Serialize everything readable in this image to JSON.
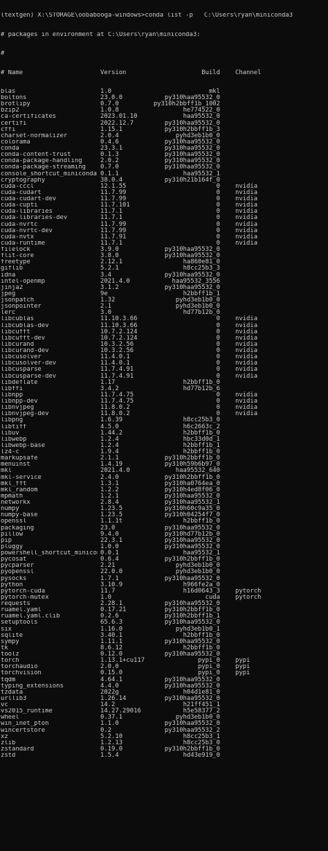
{
  "terminal": {
    "prompt_line": "(textgen) X:\\STORAGE\\oobabooga-windows>conda list -p   C:\\Users\\ryan\\miniconda3",
    "info_line": "# packages in environment at C:\\Users\\ryan\\miniconda3:",
    "hash_line": "#",
    "columns": {
      "name": "# Name",
      "version": "Version",
      "build": "Build",
      "channel": "Channel"
    },
    "packages": [
      [
        "blas",
        "1.0",
        "mkl",
        ""
      ],
      [
        "boltons",
        "23.0.0",
        "py310haa95532_0",
        ""
      ],
      [
        "brotlipy",
        "0.7.0",
        "py310h2bbff1b_1002",
        ""
      ],
      [
        "bzip2",
        "1.0.8",
        "he774522_0",
        ""
      ],
      [
        "ca-certificates",
        "2023.01.10",
        "haa95532_0",
        ""
      ],
      [
        "certifi",
        "2022.12.7",
        "py310haa95532_0",
        ""
      ],
      [
        "cffi",
        "1.15.1",
        "py310h2bbff1b_3",
        ""
      ],
      [
        "charset-normalizer",
        "2.0.4",
        "pyhd3eb1b0_0",
        ""
      ],
      [
        "colorama",
        "0.4.6",
        "py310haa95532_0",
        ""
      ],
      [
        "conda",
        "23.3.1",
        "py310haa95532_0",
        ""
      ],
      [
        "conda-content-trust",
        "0.1.3",
        "py310haa95532_0",
        ""
      ],
      [
        "conda-package-handling",
        "2.0.2",
        "py310haa95532_0",
        ""
      ],
      [
        "conda-package-streaming",
        "0.7.0",
        "py310haa95532_0",
        ""
      ],
      [
        "console_shortcut_miniconda",
        "0.1.1",
        "haa95532_1",
        ""
      ],
      [
        "cryptography",
        "38.0.4",
        "py310h21b164f_0",
        ""
      ],
      [
        "cuda-cccl",
        "12.1.55",
        "0",
        "nvidia"
      ],
      [
        "cuda-cudart",
        "11.7.99",
        "0",
        "nvidia"
      ],
      [
        "cuda-cudart-dev",
        "11.7.99",
        "0",
        "nvidia"
      ],
      [
        "cuda-cupti",
        "11.7.101",
        "0",
        "nvidia"
      ],
      [
        "cuda-libraries",
        "11.7.1",
        "0",
        "nvidia"
      ],
      [
        "cuda-libraries-dev",
        "11.7.1",
        "0",
        "nvidia"
      ],
      [
        "cuda-nvrtc",
        "11.7.99",
        "0",
        "nvidia"
      ],
      [
        "cuda-nvrtc-dev",
        "11.7.99",
        "0",
        "nvidia"
      ],
      [
        "cuda-nvtx",
        "11.7.91",
        "0",
        "nvidia"
      ],
      [
        "cuda-runtime",
        "11.7.1",
        "0",
        "nvidia"
      ],
      [
        "filelock",
        "3.9.0",
        "py310haa95532_0",
        ""
      ],
      [
        "flit-core",
        "3.8.0",
        "py310haa95532_0",
        ""
      ],
      [
        "freetype",
        "2.12.1",
        "ha860e81_0",
        ""
      ],
      [
        "giflib",
        "5.2.1",
        "h8cc25b3_3",
        ""
      ],
      [
        "idna",
        "3.4",
        "py310haa95532_0",
        ""
      ],
      [
        "intel-openmp",
        "2021.4.0",
        "haa95532_3556",
        ""
      ],
      [
        "jinja2",
        "3.1.2",
        "py310haa95532_0",
        ""
      ],
      [
        "jpeg",
        "9e",
        "h2bbff1b_1",
        ""
      ],
      [
        "jsonpatch",
        "1.32",
        "pyhd3eb1b0_0",
        ""
      ],
      [
        "jsonpointer",
        "2.1",
        "pyhd3eb1b0_0",
        ""
      ],
      [
        "lerc",
        "3.0",
        "hd77b12b_0",
        ""
      ],
      [
        "libcublas",
        "11.10.3.66",
        "0",
        "nvidia"
      ],
      [
        "libcublas-dev",
        "11.10.3.66",
        "0",
        "nvidia"
      ],
      [
        "libcufft",
        "10.7.2.124",
        "0",
        "nvidia"
      ],
      [
        "libcufft-dev",
        "10.7.2.124",
        "0",
        "nvidia"
      ],
      [
        "libcurand",
        "10.3.2.56",
        "0",
        "nvidia"
      ],
      [
        "libcurand-dev",
        "10.3.2.56",
        "0",
        "nvidia"
      ],
      [
        "libcusolver",
        "11.4.0.1",
        "0",
        "nvidia"
      ],
      [
        "libcusolver-dev",
        "11.4.0.1",
        "0",
        "nvidia"
      ],
      [
        "libcusparse",
        "11.7.4.91",
        "0",
        "nvidia"
      ],
      [
        "libcusparse-dev",
        "11.7.4.91",
        "0",
        "nvidia"
      ],
      [
        "libdeflate",
        "1.17",
        "h2bbff1b_0",
        ""
      ],
      [
        "libffi",
        "3.4.2",
        "hd77b12b_6",
        ""
      ],
      [
        "libnpp",
        "11.7.4.75",
        "0",
        "nvidia"
      ],
      [
        "libnpp-dev",
        "11.7.4.75",
        "0",
        "nvidia"
      ],
      [
        "libnvjpeg",
        "11.8.0.2",
        "0",
        "nvidia"
      ],
      [
        "libnvjpeg-dev",
        "11.8.0.2",
        "0",
        "nvidia"
      ],
      [
        "libpng",
        "1.6.39",
        "h8cc25b3_0",
        ""
      ],
      [
        "libtiff",
        "4.5.0",
        "h6c2663c_2",
        ""
      ],
      [
        "libuv",
        "1.44.2",
        "h2bbff1b_0",
        ""
      ],
      [
        "libwebp",
        "1.2.4",
        "hbc33d0d_1",
        ""
      ],
      [
        "libwebp-base",
        "1.2.4",
        "h2bbff1b_1",
        ""
      ],
      [
        "lz4-c",
        "1.9.4",
        "h2bbff1b_0",
        ""
      ],
      [
        "markupsafe",
        "2.1.1",
        "py310h2bbff1b_0",
        ""
      ],
      [
        "menuinst",
        "1.4.19",
        "py310h59b6b97_0",
        ""
      ],
      [
        "mkl",
        "2021.4.0",
        "haa95532_640",
        ""
      ],
      [
        "mkl-service",
        "2.4.0",
        "py310h2bbff1b_0",
        ""
      ],
      [
        "mkl_fft",
        "1.3.1",
        "py310ha0764ea_0",
        ""
      ],
      [
        "mkl_random",
        "1.2.2",
        "py310h4ed8f06_0",
        ""
      ],
      [
        "mpmath",
        "1.2.1",
        "py310haa95532_0",
        ""
      ],
      [
        "networkx",
        "2.8.4",
        "py310haa95532_1",
        ""
      ],
      [
        "numpy",
        "1.23.5",
        "py310h60c9a35_0",
        ""
      ],
      [
        "numpy-base",
        "1.23.5",
        "py310h04254f7_0",
        ""
      ],
      [
        "openssl",
        "1.1.1t",
        "h2bbff1b_0",
        ""
      ],
      [
        "packaging",
        "23.0",
        "py310haa95532_0",
        ""
      ],
      [
        "pillow",
        "9.4.0",
        "py310hd77b12b_0",
        ""
      ],
      [
        "pip",
        "22.3.1",
        "py310haa95532_0",
        ""
      ],
      [
        "pluggy",
        "1.0.0",
        "py310haa95532_0",
        ""
      ],
      [
        "powershell_shortcut_miniconda",
        "0.0.1",
        "haa95532_1",
        ""
      ],
      [
        "pycosat",
        "0.6.4",
        "py310h2bbff1b_0",
        ""
      ],
      [
        "pycparser",
        "2.21",
        "pyhd3eb1b0_0",
        ""
      ],
      [
        "pyopenssl",
        "22.0.0",
        "pyhd3eb1b0_0",
        ""
      ],
      [
        "pysocks",
        "1.7.1",
        "py310haa95532_0",
        ""
      ],
      [
        "python",
        "3.10.9",
        "h966fe2a_0",
        ""
      ],
      [
        "pytorch-cuda",
        "11.7",
        "h16d0643_3",
        "pytorch"
      ],
      [
        "pytorch-mutex",
        "1.0",
        "cuda",
        "pytorch"
      ],
      [
        "requests",
        "2.28.1",
        "py310haa95532_0",
        ""
      ],
      [
        "ruamel.yaml",
        "0.17.21",
        "py310h2bbff1b_0",
        ""
      ],
      [
        "ruamel.yaml.clib",
        "0.2.6",
        "py310h2bbff1b_1",
        ""
      ],
      [
        "setuptools",
        "65.6.3",
        "py310haa95532_0",
        ""
      ],
      [
        "six",
        "1.16.0",
        "pyhd3eb1b0_1",
        ""
      ],
      [
        "sqlite",
        "3.40.1",
        "h2bbff1b_0",
        ""
      ],
      [
        "sympy",
        "1.11.1",
        "py310haa95532_0",
        ""
      ],
      [
        "tk",
        "8.6.12",
        "h2bbff1b_0",
        ""
      ],
      [
        "toolz",
        "0.12.0",
        "py310haa95532_0",
        ""
      ],
      [
        "torch",
        "1.13.1+cu117",
        "pypi_0",
        "pypi"
      ],
      [
        "torchaudio",
        "2.0.0",
        "pypi_0",
        "pypi"
      ],
      [
        "torchvision",
        "0.15.0",
        "pypi_0",
        "pypi"
      ],
      [
        "tqdm",
        "4.64.1",
        "py310haa95532_0",
        ""
      ],
      [
        "typing_extensions",
        "4.4.0",
        "py310haa95532_0",
        ""
      ],
      [
        "tzdata",
        "2022g",
        "h04d1e81_0",
        ""
      ],
      [
        "urllib3",
        "1.26.14",
        "py310haa95532_0",
        ""
      ],
      [
        "vc",
        "14.2",
        "h21ff451_1",
        ""
      ],
      [
        "vs2015_runtime",
        "14.27.29016",
        "h5e58377_2",
        ""
      ],
      [
        "wheel",
        "0.37.1",
        "pyhd3eb1b0_0",
        ""
      ],
      [
        "win_inet_pton",
        "1.1.0",
        "py310haa95532_0",
        ""
      ],
      [
        "wincertstore",
        "0.2",
        "py310haa95532_2",
        ""
      ],
      [
        "xz",
        "5.2.10",
        "h8cc25b3_1",
        ""
      ],
      [
        "zlib",
        "1.2.13",
        "h8cc25b3_0",
        ""
      ],
      [
        "zstandard",
        "0.19.0",
        "py310h2bbff1b_0",
        ""
      ],
      [
        "zstd",
        "1.5.4",
        "hd43e919_0",
        ""
      ]
    ]
  }
}
